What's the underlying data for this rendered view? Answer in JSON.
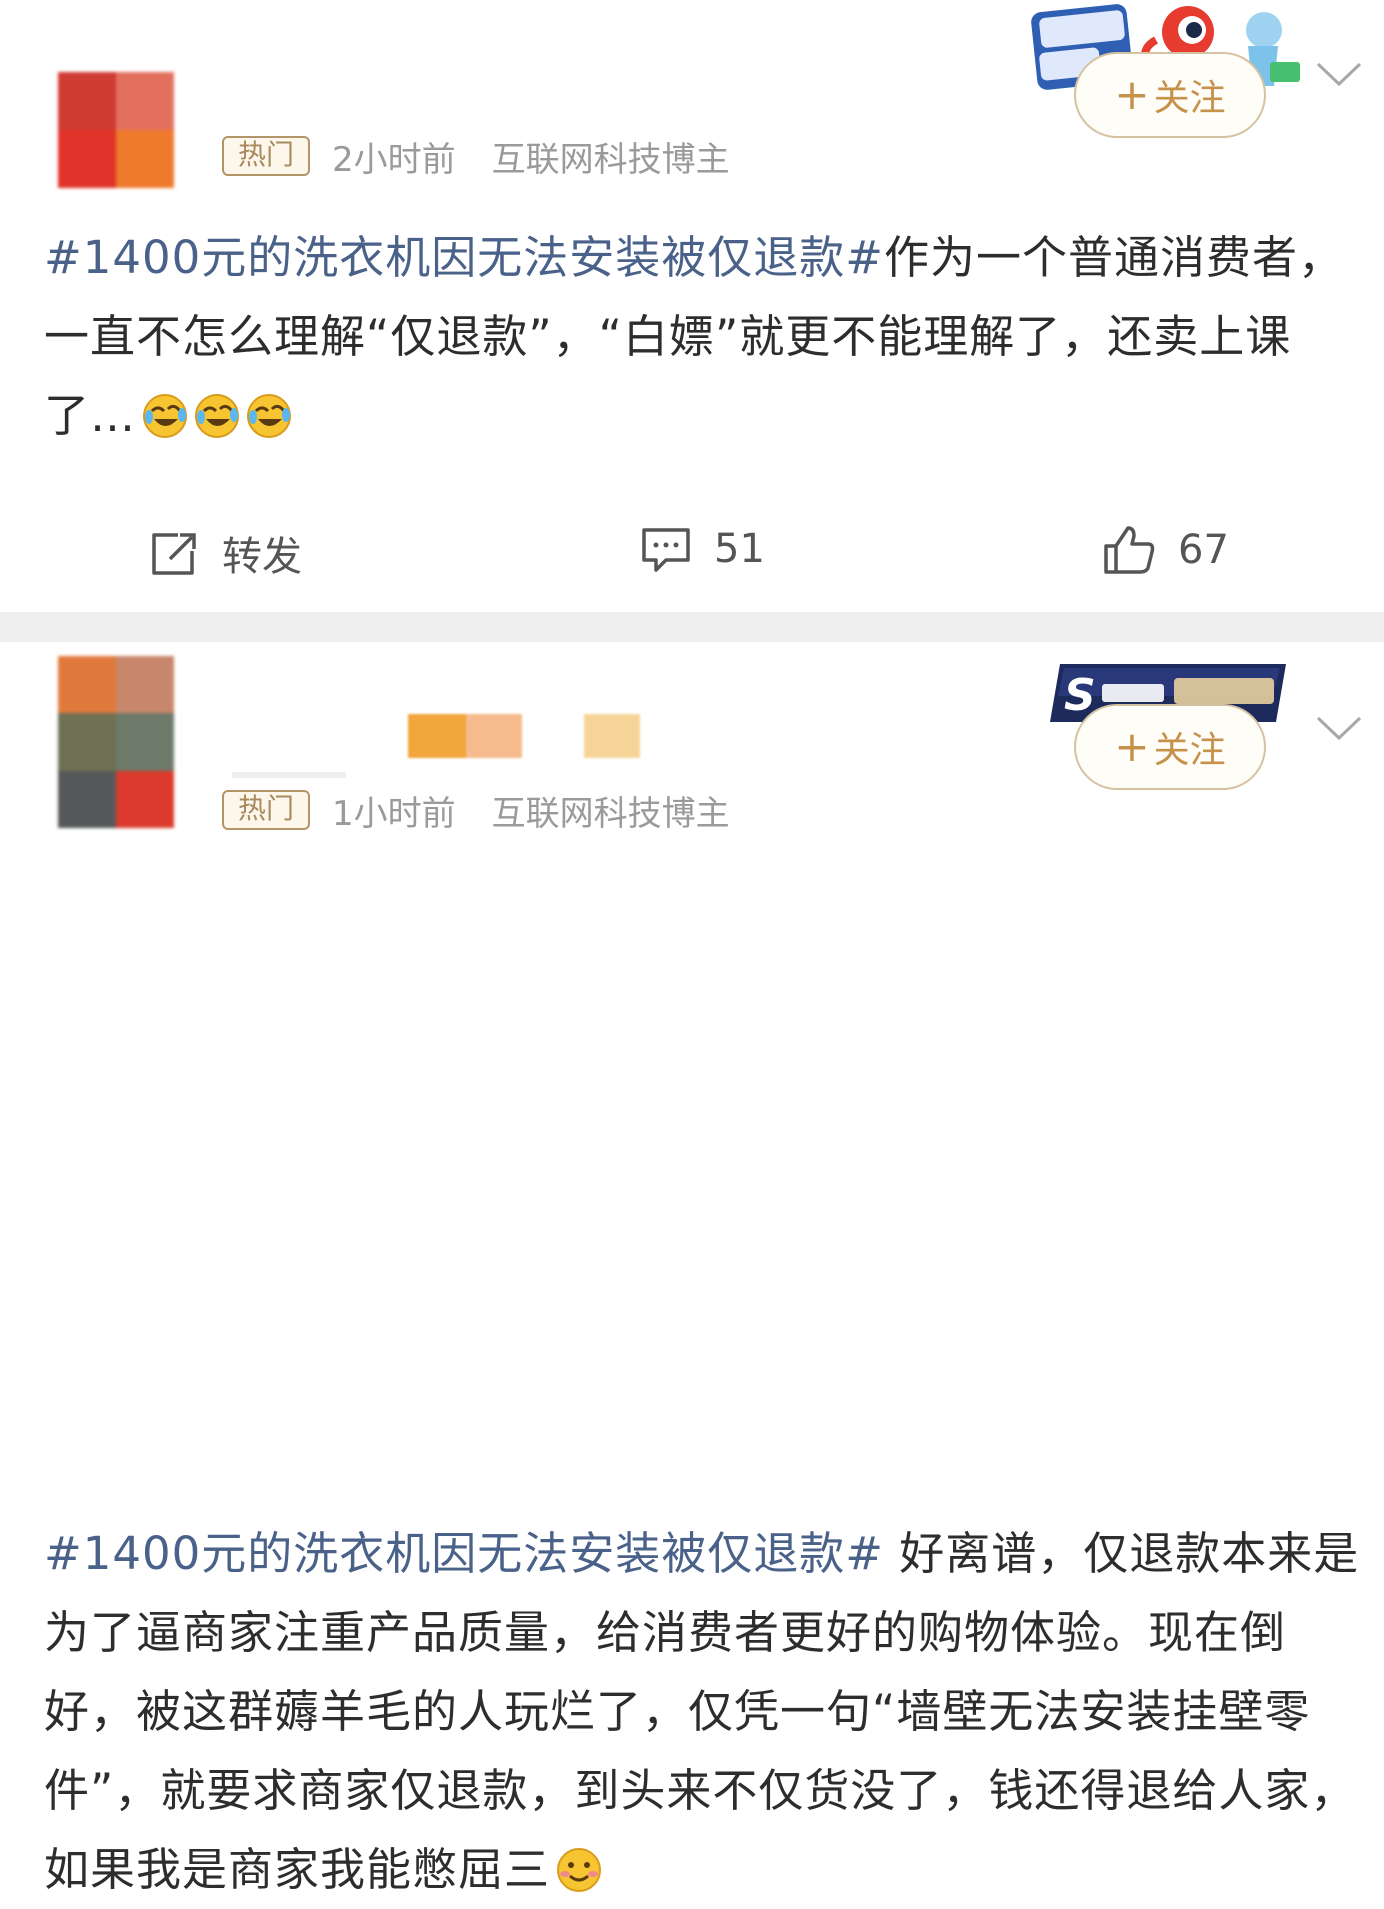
{
  "posts": [
    {
      "badge": "热门",
      "time": "2小时前",
      "category": "互联网科技博主",
      "follow_label": "关注",
      "topic": "#1400元的洗衣机因无法安装被仅退款#",
      "body": "作为一个普通消费者，一直不怎么理解“仅退款”，“白嫖”就更不能理解了，还卖上课了…",
      "emojis": [
        "laugh-cry-emoji",
        "laugh-cry-emoji",
        "laugh-cry-emoji"
      ],
      "actions": {
        "repost_label": "转发",
        "comment_count": "51",
        "like_count": "67"
      }
    },
    {
      "badge": "热门",
      "time": "1小时前",
      "category": "互联网科技博主",
      "follow_label": "关注",
      "topic": "#1400元的洗衣机因无法安装被仅退款#",
      "body": " 好离谱，仅退款本来是为了逼商家注重产品质量，给消费者更好的购物体验。现在倒好，被这群薅羊毛的人玩烂了，仅凭一句“墙壁无法安装挂壁零件”，就要求商家仅退款，到头来不仅货没了，钱还得退给人家， 如果我是商家我能憋屈三",
      "emojis": [
        "smirk-emoji"
      ]
    }
  ],
  "colors": {
    "topic": "#4a6189",
    "follow_text": "#c6914a",
    "badge_border": "#b39569",
    "separator": "#efefef"
  }
}
